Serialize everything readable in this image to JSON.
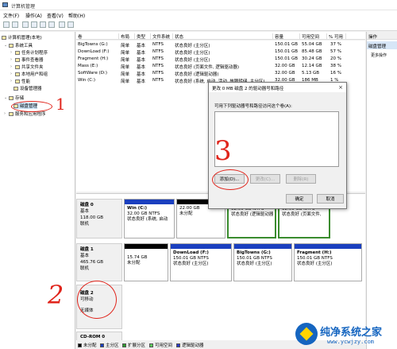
{
  "window": {
    "title": "计算机管理"
  },
  "menu": [
    "文件(F)",
    "操作(A)",
    "查看(V)",
    "帮助(H)"
  ],
  "tree": {
    "root": "计算机管理(本地)",
    "system_tools": "系统工具",
    "task_scheduler": "任务计划程序",
    "event_viewer": "事件查看器",
    "shared_folders": "共享文件夹",
    "local_users": "本地用户和组",
    "performance": "性能",
    "device_manager": "设备管理器",
    "storage": "存储",
    "disk_management": "磁盘管理",
    "services_apps": "服务和应用程序"
  },
  "columns": [
    "卷",
    "布局",
    "类型",
    "文件系统",
    "状态",
    "容量",
    "可用空间",
    "% 可用"
  ],
  "volumes": [
    {
      "name": "BigTowns (G:)",
      "layout": "简单",
      "type": "基本",
      "fs": "NTFS",
      "status": "状态良好 (主分区)",
      "capacity": "150.01 GB",
      "free": "55.04 GB",
      "pct": "37 %"
    },
    {
      "name": "DownLoad (F:)",
      "layout": "简单",
      "type": "基本",
      "fs": "NTFS",
      "status": "状态良好 (主分区)",
      "capacity": "150.01 GB",
      "free": "85.48 GB",
      "pct": "57 %"
    },
    {
      "name": "Fragment (H:)",
      "layout": "简单",
      "type": "基本",
      "fs": "NTFS",
      "status": "状态良好 (主分区)",
      "capacity": "150.01 GB",
      "free": "30.24 GB",
      "pct": "20 %"
    },
    {
      "name": "Mass (E:)",
      "layout": "简单",
      "type": "基本",
      "fs": "NTFS",
      "status": "状态良好 (页面文件, 逻辑驱动器)",
      "capacity": "32.00 GB",
      "free": "12.14 GB",
      "pct": "38 %"
    },
    {
      "name": "SoftWare (D:)",
      "layout": "简单",
      "type": "基本",
      "fs": "NTFS",
      "status": "状态良好 (逻辑驱动器)",
      "capacity": "32.00 GB",
      "free": "5.13 GB",
      "pct": "16 %"
    },
    {
      "name": "Win (C:)",
      "layout": "简单",
      "type": "基本",
      "fs": "NTFS",
      "status": "状态良好 (系统, 启动, 活动, 故障转储, 主分区)",
      "capacity": "32.00 GB",
      "free": "186 MB",
      "pct": "1 %"
    }
  ],
  "actions": {
    "header": "操作",
    "selected": "磁盘管理",
    "more": "更多操作"
  },
  "disks": [
    {
      "name": "磁盘 0",
      "type": "基本",
      "size": "118.00 GB",
      "status": "联机",
      "partitions": [
        {
          "title": "Win (C:)",
          "line1": "32.00 GB NTFS",
          "line2": "状态良好 (系统, 启动",
          "bar": "#1a3fbf"
        },
        {
          "title": "",
          "line1": "22.00 GB",
          "line2": "未分配",
          "bar": "#000000"
        },
        {
          "title": "",
          "line1": "32.00 GB NTFS",
          "line2": "状态良好 (逻辑驱动器",
          "bar": "#1a3fbf"
        },
        {
          "title": "",
          "line1": "32.00 GB NTFS",
          "line2": "状态良好 (页面文件,",
          "bar": "#1a3fbf"
        }
      ]
    },
    {
      "name": "磁盘 1",
      "type": "基本",
      "size": "465.76 GB",
      "status": "联机",
      "partitions": [
        {
          "title": "",
          "line1": "15.74 GB",
          "line2": "未分配",
          "bar": "#000000"
        },
        {
          "title": "DownLoad (F:)",
          "line1": "150.01 GB NTFS",
          "line2": "状态良好 (主分区)",
          "bar": "#1a3fbf"
        },
        {
          "title": "BigTowns (G:)",
          "line1": "150.01 GB NTFS",
          "line2": "状态良好 (主分区)",
          "bar": "#1a3fbf"
        },
        {
          "title": "Fragment (H:)",
          "line1": "150.01 GB NTFS",
          "line2": "状态良好 (主分区)",
          "bar": "#1a3fbf"
        }
      ]
    },
    {
      "name": "磁盘 2",
      "type": "可移动",
      "size": "",
      "status": "无媒体",
      "partitions": []
    },
    {
      "name": "CD-ROM 0",
      "type": "",
      "size": "",
      "status": "",
      "partitions": []
    }
  ],
  "legend": [
    {
      "label": "未分配",
      "color": "#000000"
    },
    {
      "label": "主分区",
      "color": "#1a3fbf"
    },
    {
      "label": "扩展分区",
      "color": "#2e9a2e"
    },
    {
      "label": "可用空间",
      "color": "#5cc95c"
    },
    {
      "label": "逻辑驱动器",
      "color": "#2838c8"
    }
  ],
  "dialog": {
    "title": "更改 0 MB 磁盘 2 的驱动器号和路径",
    "close": "×",
    "prompt": "可用下列驱动器号和路径访问这个卷(A):",
    "add": "添加(D)...",
    "change": "更改(C)...",
    "remove": "删除(R)",
    "ok": "确定",
    "cancel": "取消"
  },
  "annotations": {
    "n1": "1",
    "n2": "2",
    "n3": "3"
  },
  "watermark": {
    "site": "纯净系统之家",
    "url": "www.ycwjzy.com"
  }
}
